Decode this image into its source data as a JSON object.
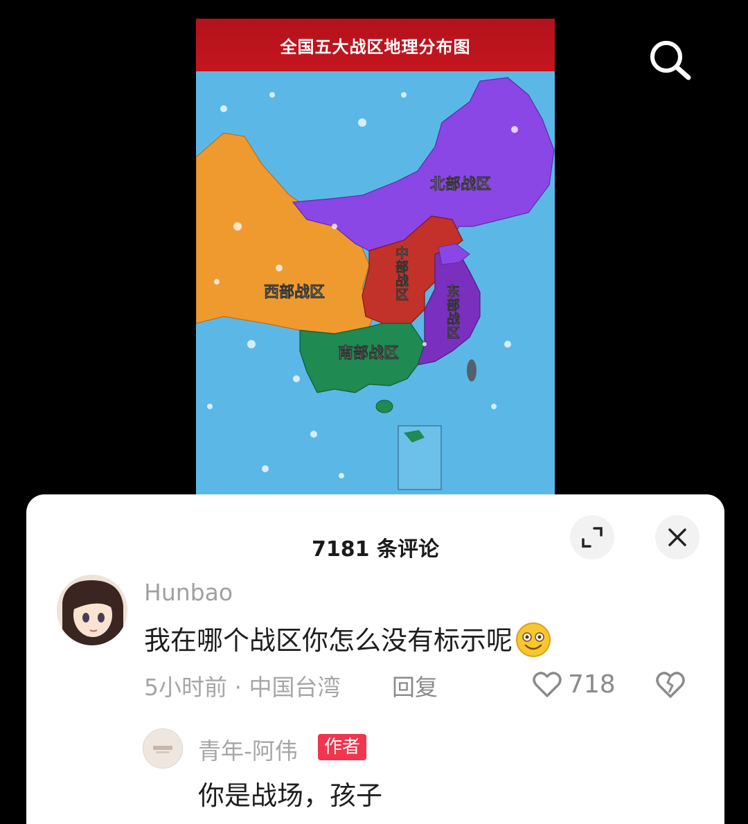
{
  "video": {
    "map_title": "全国五大战区地理分布图",
    "regions": {
      "north": "北部战区",
      "west": "西部战区",
      "central": "中部战区",
      "east": "东部战区",
      "south": "南部战区"
    },
    "colors": {
      "north": "#8a47e6",
      "west": "#ef9a2f",
      "central": "#c2322a",
      "east": "#7a2fbf",
      "south": "#1f8a52",
      "sea": "#5bb8e6",
      "banner": "#c4161f"
    }
  },
  "top_bar": {
    "search_icon": "search-icon"
  },
  "comments_panel": {
    "title": "7181 条评论",
    "expand_icon": "expand-icon",
    "close_icon": "close-icon",
    "comment": {
      "username": "Hunbao",
      "text": "我在哪个战区你怎么没有标示呢",
      "emoji": "smiling-face-emoji",
      "time": "5小时前",
      "separator": "·",
      "location": "中国台湾",
      "reply_label": "回复",
      "likes": "718",
      "like_icon": "heart-icon",
      "dislike_icon": "broken-heart-icon"
    },
    "reply": {
      "username": "青年-阿伟",
      "badge": "作者",
      "text": "你是战场，孩子"
    }
  }
}
